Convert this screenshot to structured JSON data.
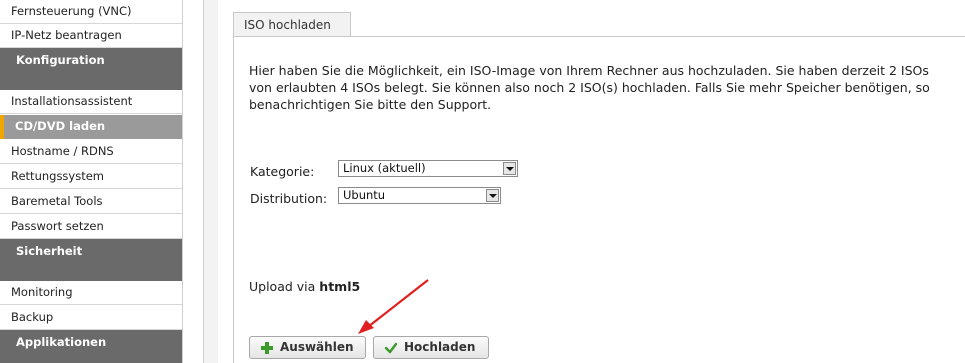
{
  "sidebar": {
    "items": [
      {
        "label": "Fernsteuerung (VNC)"
      },
      {
        "label": "IP-Netz beantragen"
      },
      {
        "label": "Installationsassistent"
      },
      {
        "label": "Hostname / RDNS"
      },
      {
        "label": "Rettungssystem"
      },
      {
        "label": "Baremetal Tools"
      },
      {
        "label": "Passwort setzen"
      },
      {
        "label": "Monitoring"
      },
      {
        "label": "Backup"
      }
    ],
    "headers": {
      "konfiguration": "Konfiguration",
      "sicherheit": "Sicherheit",
      "applikationen": "Applikationen"
    },
    "active_item": "CD/DVD laden"
  },
  "tab": {
    "label": "ISO hochladen"
  },
  "content": {
    "intro_text": "Hier haben Sie die Möglichkeit, ein ISO-Image von Ihrem Rechner aus hochzuladen. Sie haben derzeit 2 ISOs von erlaubten 4 ISOs belegt. Sie können also noch 2 ISO(s) hochladen. Falls Sie mehr Speicher benötigen, so benachrichtigen Sie bitte den Support.",
    "kategorie_label": "Kategorie:",
    "kategorie_value": "Linux (aktuell)",
    "distribution_label": "Distribution:",
    "distribution_value": "Ubuntu",
    "upload_prefix": "Upload via",
    "upload_method": "html5"
  },
  "buttons": {
    "select": "Auswählen",
    "upload": "Hochladen"
  },
  "colors": {
    "accent": "#f0a500",
    "header_bg": "#6a6a6a",
    "active_bg": "#9a9a9a",
    "annotation_arrow": "#e02020"
  }
}
